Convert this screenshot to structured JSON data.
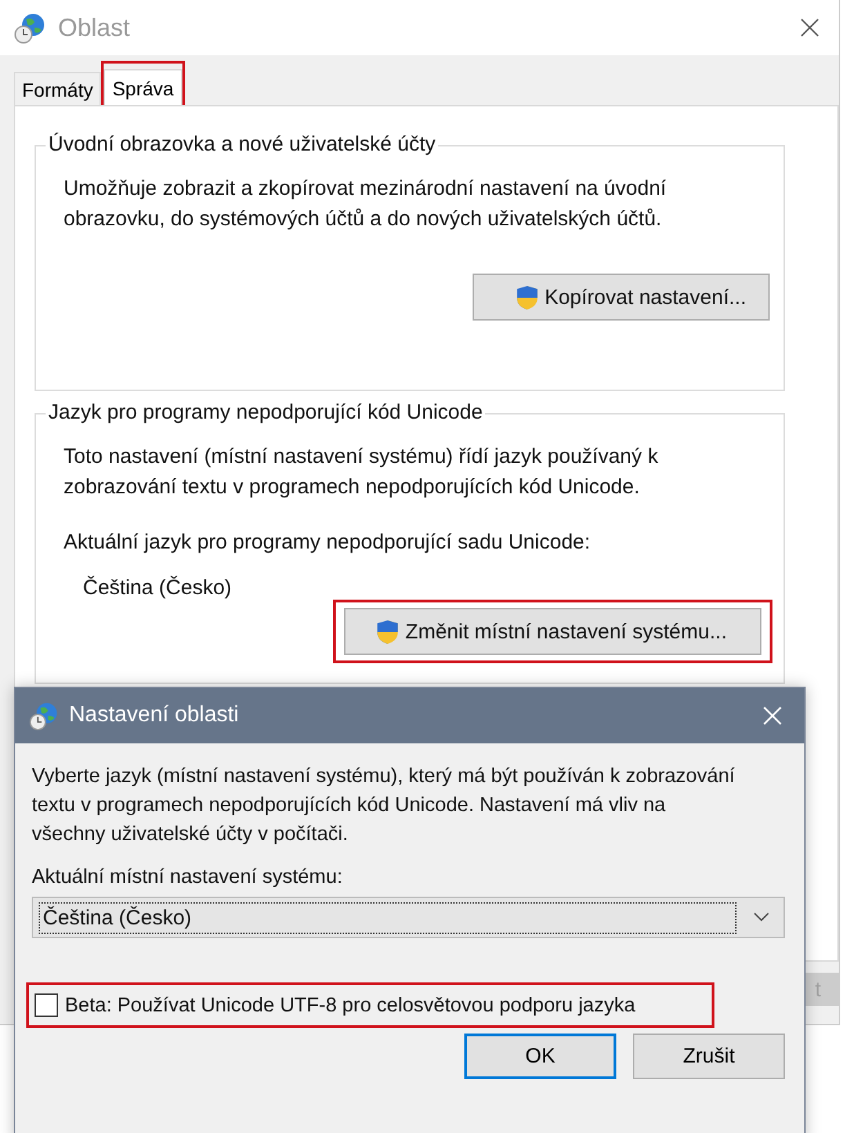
{
  "window": {
    "title": "Oblast"
  },
  "tabs": [
    {
      "label": "Formáty",
      "selected": false,
      "highlighted": false
    },
    {
      "label": "Správa",
      "selected": true,
      "highlighted": true
    }
  ],
  "groups": [
    {
      "title": "Úvodní obrazovka a nové uživatelské účty",
      "description": "Umožňuje zobrazit a zkopírovat mezinárodní nastavení na úvodní obrazovku, do systémových účtů a do nových uživatelských účtů.",
      "button": {
        "label": "Kopírovat nastavení...",
        "shield": true,
        "highlighted": false
      }
    },
    {
      "title": "Jazyk pro programy nepodporující kód Unicode",
      "description": "Toto nastavení (místní nastavení systému) řídí jazyk používaný k zobrazování textu v programech nepodporujících kód Unicode.",
      "current_label": "Aktuální jazyk pro programy nepodporující sadu Unicode:",
      "current_value": "Čeština (Česko)",
      "button": {
        "label": "Změnit místní nastavení systému...",
        "shield": true,
        "highlighted": true
      }
    }
  ],
  "partial_button": {
    "label": "t",
    "disabled": true
  },
  "dialog": {
    "title": "Nastavení oblasti",
    "description": "Vyberte jazyk (místní nastavení systému), který má být používán k zobrazování textu v programech nepodporujících kód Unicode. Nastavení má vliv na všechny uživatelské účty v počítači.",
    "locale_label": "Aktuální místní nastavení systému:",
    "locale_value": "Čeština (Česko)",
    "beta_checkbox": {
      "label": "Beta: Používat Unicode UTF-8 pro celosvětovou podporu jazyka",
      "checked": false,
      "highlighted": true
    },
    "buttons": [
      {
        "label": "OK",
        "default": true
      },
      {
        "label": "Zrušit",
        "default": false
      }
    ]
  }
}
